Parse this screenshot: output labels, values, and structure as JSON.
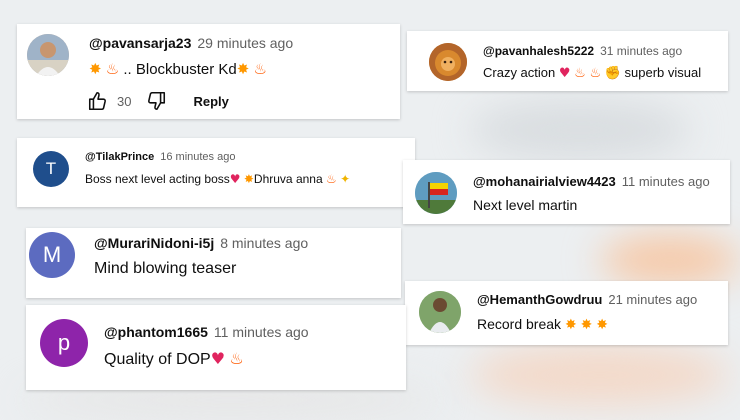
{
  "colors": {
    "background": "#eceff1",
    "card": "#ffffff",
    "username": "#0f0f0f",
    "timestamp": "#606060",
    "heart": "#e0245e",
    "fire": "#ff7a00",
    "collision": "#ffb300",
    "avatar_t": "#1f4e8c",
    "avatar_m": "#5c6bc0",
    "avatar_p": "#8e24aa"
  },
  "comments": [
    {
      "username": "@pavansarja23",
      "time": "29 minutes ago",
      "text_prefix": ".. Blockbuster Kd",
      "avatar_icon": "person-photo-avatar",
      "like_count": "30",
      "reply_label": "Reply"
    },
    {
      "username": "@pavanhalesh5222",
      "time": "31 minutes ago",
      "text_prefix": "Crazy action",
      "text_suffix": "superb visual",
      "avatar_icon": "lion-photo-avatar"
    },
    {
      "username": "@TilakPrince",
      "time": "16 minutes ago",
      "avatar_letter": "T",
      "text_prefix": "Boss next level acting boss",
      "text_mid": "Dhruva anna"
    },
    {
      "username": "@mohanairialview4423",
      "time": "11 minutes ago",
      "text": "Next level martin",
      "avatar_icon": "karnataka-flag-avatar"
    },
    {
      "username": "@MurariNidoni-i5j",
      "time": "8 minutes ago",
      "avatar_letter": "M",
      "text": "Mind blowing teaser"
    },
    {
      "username": "@HemanthGowdruu",
      "time": "21 minutes ago",
      "text_prefix": "Record break",
      "avatar_icon": "person-photo-avatar"
    },
    {
      "username": "@phantom1665",
      "time": "11 minutes ago",
      "avatar_letter": "p",
      "text_prefix": "Quality of DOP"
    }
  ]
}
